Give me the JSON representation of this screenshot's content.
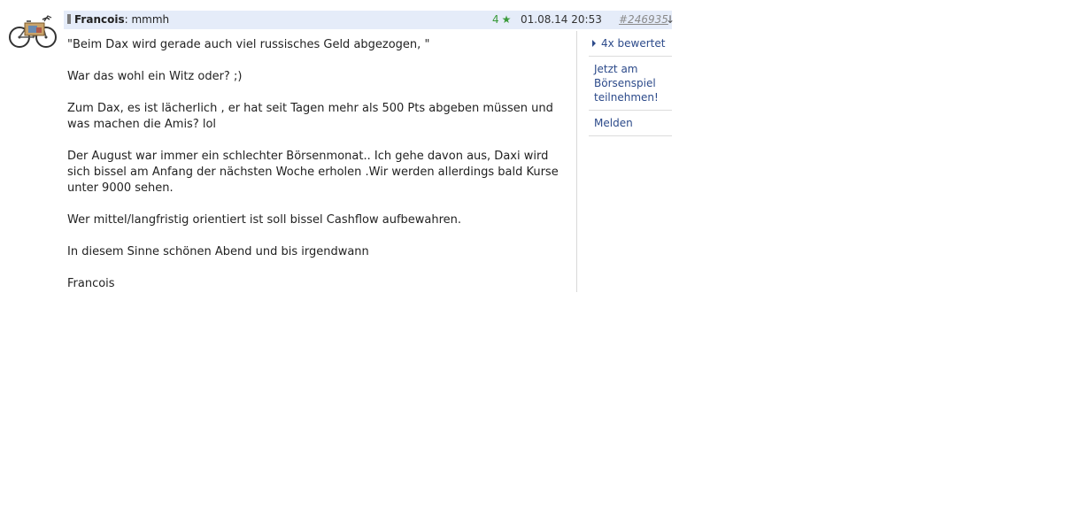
{
  "post": {
    "author": "Francois",
    "colon": ":",
    "title": "mmmh",
    "rating_count": "4",
    "rating_icon": "star-icon",
    "date": "01.08.14 20:53",
    "post_number": "#246935",
    "arrow_label": "↓",
    "body": [
      "\"Beim Dax wird gerade auch viel russisches Geld abgezogen, \"",
      "War das wohl ein Witz oder? ;)",
      "Zum Dax, es ist lächerlich , er hat seit Tagen mehr als 500 Pts abgeben müssen und was machen die Amis? lol",
      "Der August war immer ein schlechter Börsenmonat.. Ich gehe davon aus, Daxi wird sich bissel am Anfang der nächsten Woche erholen .Wir werden allerdings bald Kurse unter 9000 sehen.",
      "Wer mittel/langfristig orientiert ist soll bissel Cashflow aufbewahren.",
      "In diesem Sinne schönen Abend und bis irgendwann",
      "Francois"
    ]
  },
  "sidebar": {
    "rated": "4x bewertet",
    "game": "Jetzt am Börsenspiel teilnehmen!",
    "report": "Melden"
  },
  "colors": {
    "header_bg": "#e5ecf9",
    "rating_green": "#3a9a3a",
    "link_blue": "#2c4a8a"
  }
}
